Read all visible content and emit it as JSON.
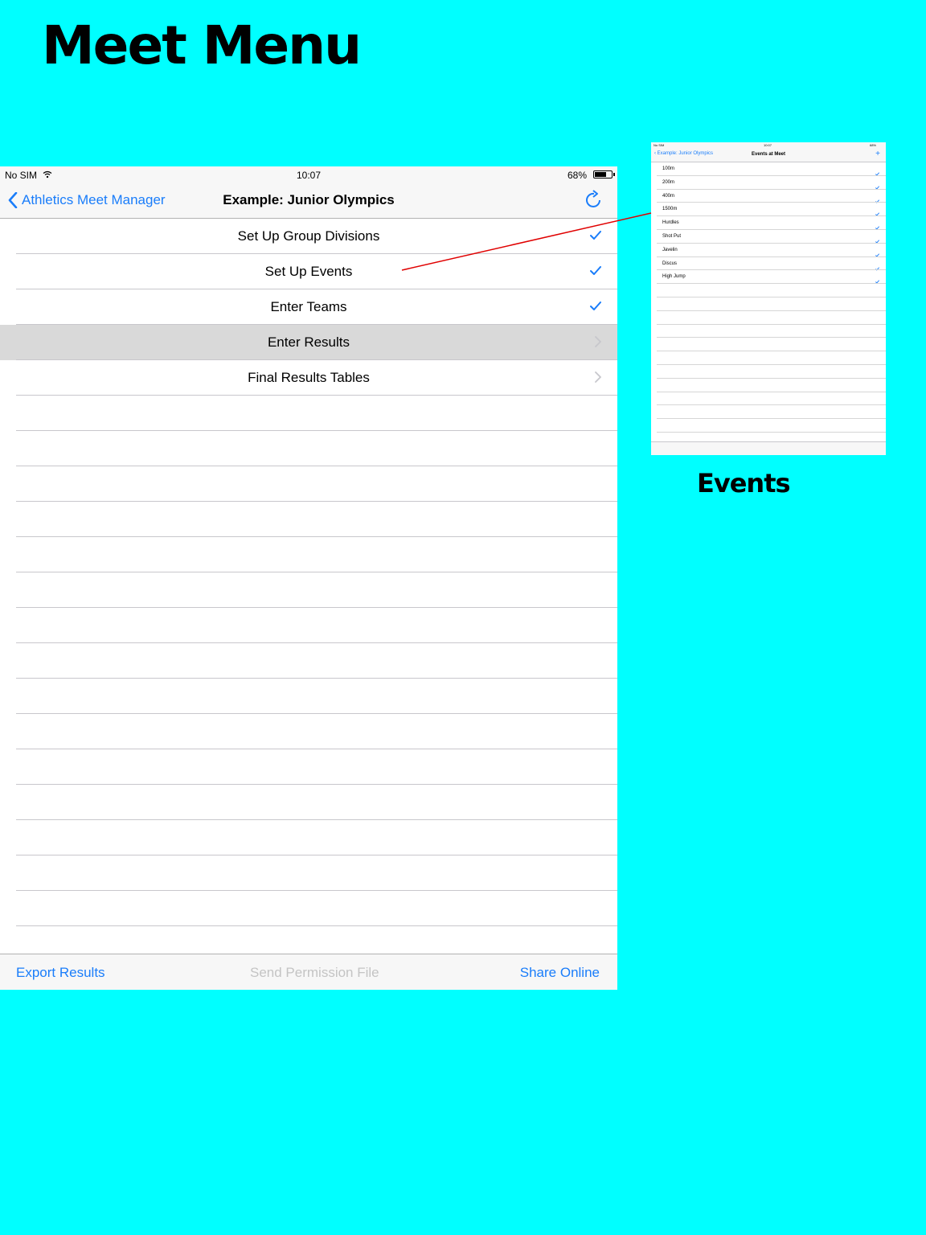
{
  "heading": "Meet Menu",
  "caption": "Events",
  "main": {
    "status": {
      "carrier": "No SIM",
      "time": "10:07",
      "battery": "68%"
    },
    "nav": {
      "back_label": "Athletics Meet Manager",
      "title": "Example: Junior Olympics"
    },
    "rows": [
      {
        "label": "Set Up Group Divisions",
        "accessory": "checkmark"
      },
      {
        "label": "Set Up Events",
        "accessory": "checkmark"
      },
      {
        "label": "Enter Teams",
        "accessory": "checkmark"
      },
      {
        "label": "Enter Results",
        "accessory": "chevron",
        "selected": true
      },
      {
        "label": "Final Results Tables",
        "accessory": "chevron"
      }
    ],
    "toolbar": {
      "export_label": "Export Results",
      "permission_label": "Send Permission File",
      "share_label": "Share Online"
    }
  },
  "mini": {
    "status": {
      "carrier": "No SIM",
      "time": "10:07",
      "battery": "68%"
    },
    "nav": {
      "back_label": "Example: Junior Olympics",
      "title": "Events at Meet",
      "add": "+"
    },
    "events": [
      "100m",
      "200m",
      "400m",
      "1500m",
      "Hurdles",
      "Shot Put",
      "Javelin",
      "Discus",
      "High Jump"
    ]
  },
  "colors": {
    "background": "#00FFFF",
    "accent": "#1A7DFA",
    "connector": "#E00000"
  }
}
